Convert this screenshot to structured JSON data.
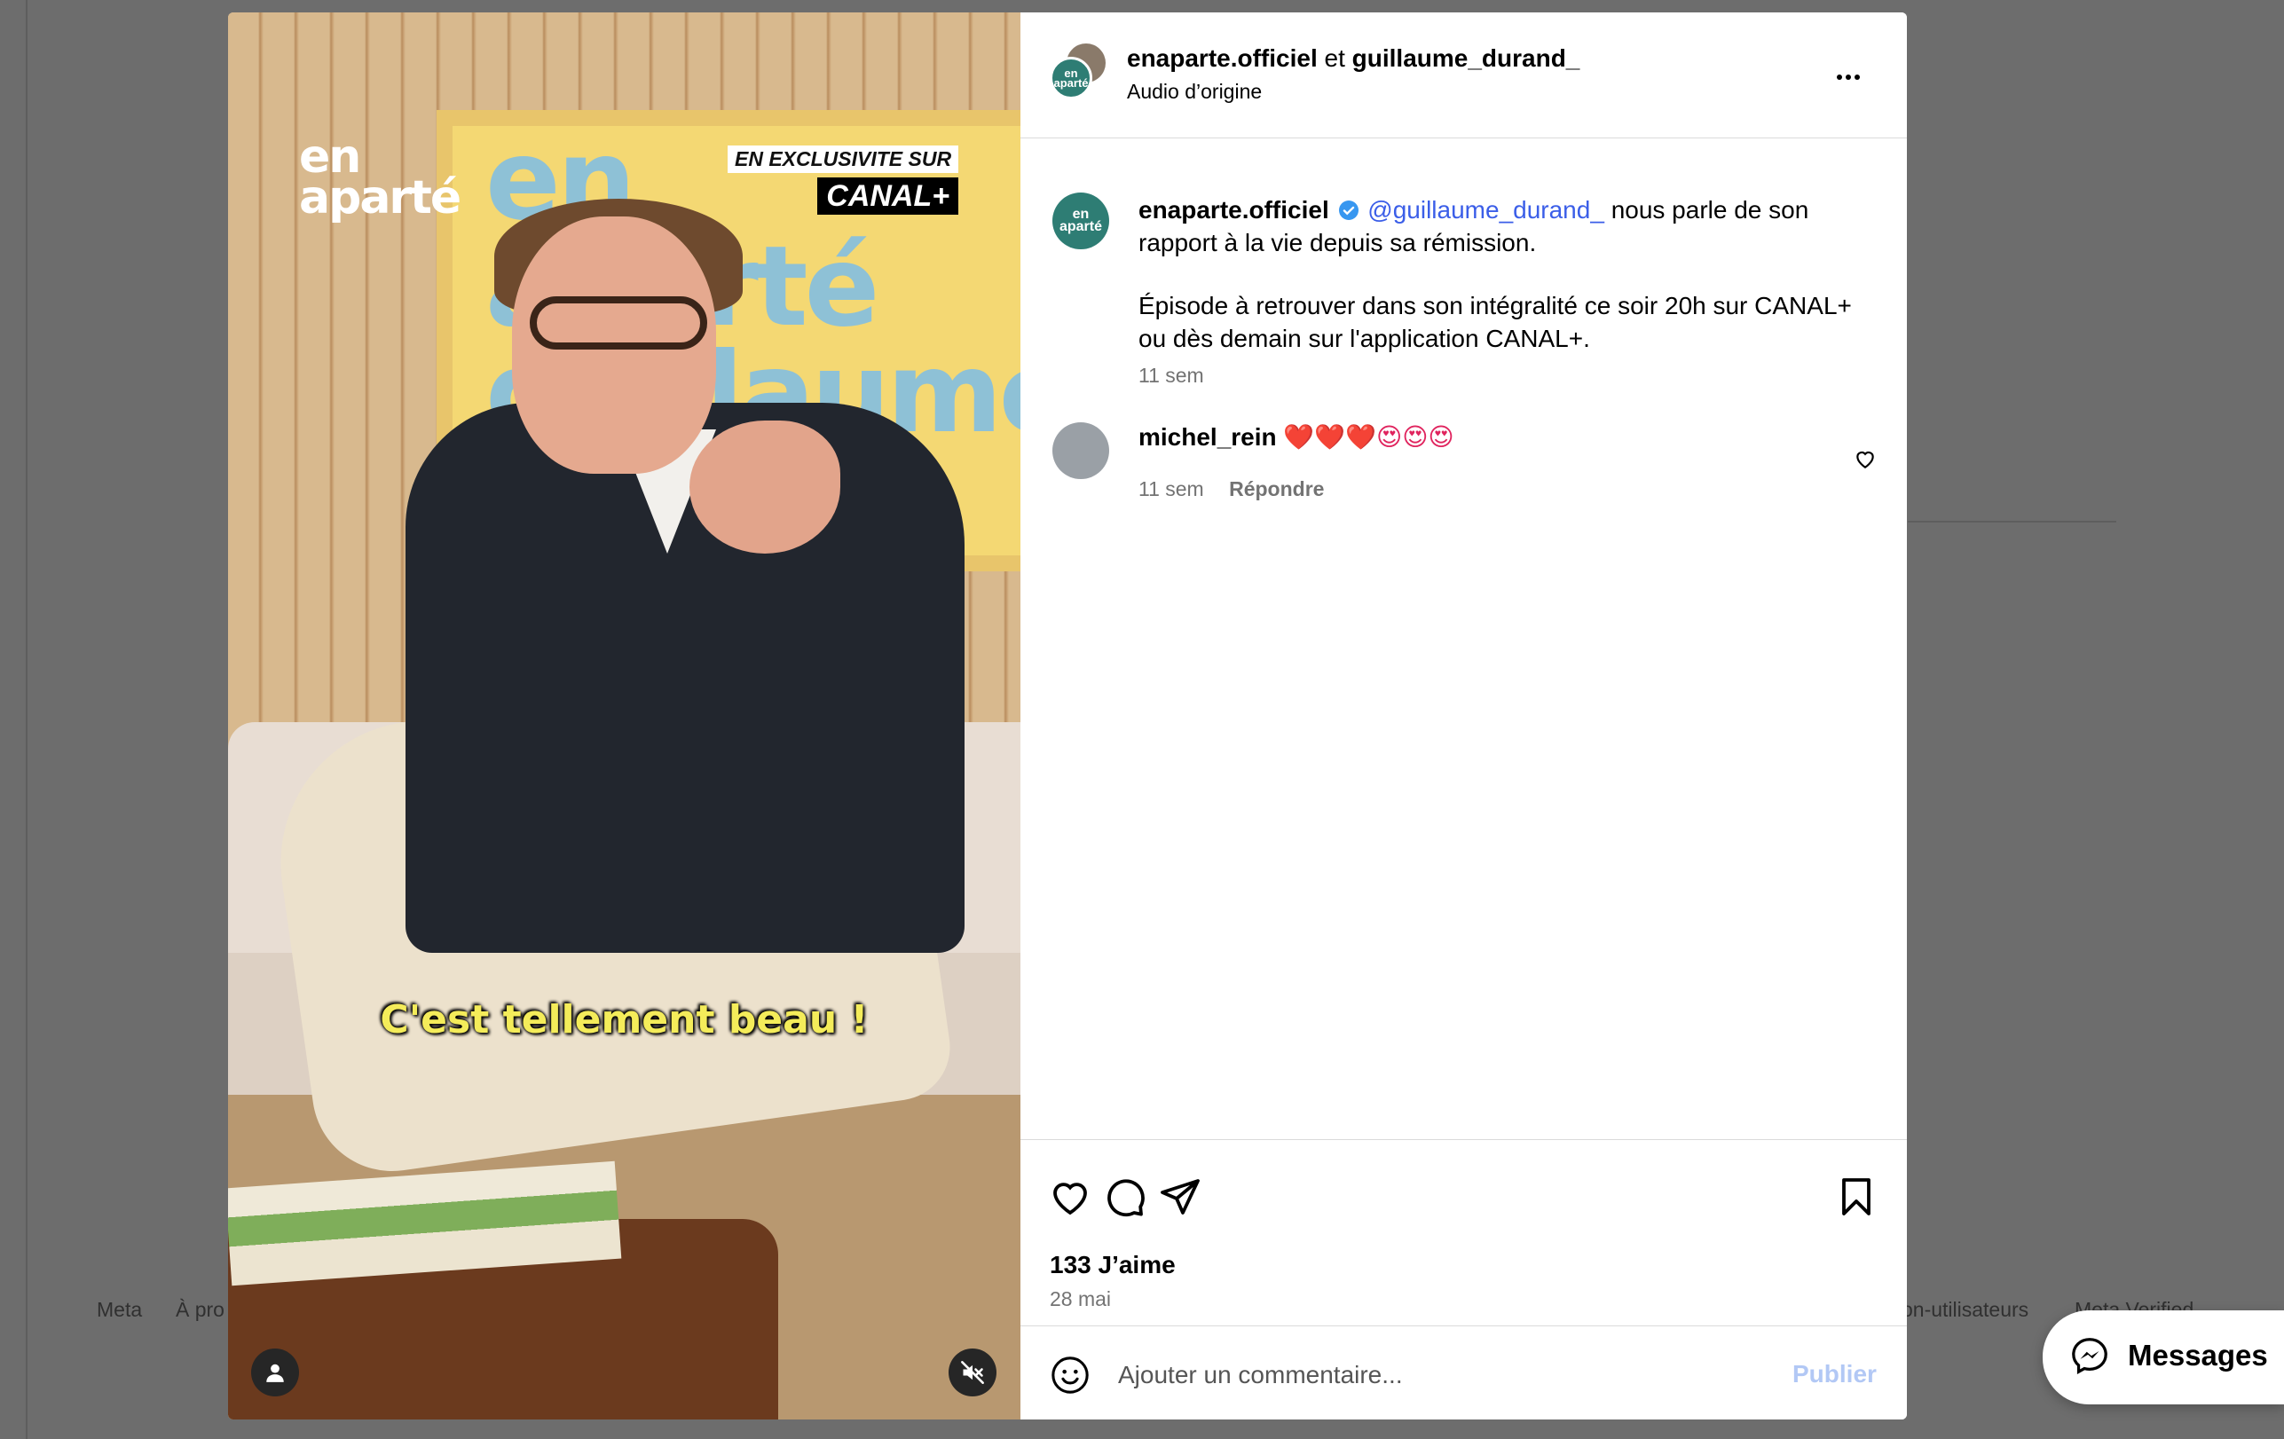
{
  "footer": {
    "meta": "Meta",
    "about": "À pro",
    "non_users": "on-utilisateurs",
    "meta_verified": "Meta Verified"
  },
  "video": {
    "logo_line1": "en",
    "logo_line2": "aparté",
    "exclusive_label": "EN EXCLUSIVITE SUR",
    "canal_label": "CANAL+",
    "subtitle": "C'est tellement beau !"
  },
  "header": {
    "user1": "enaparte.officiel",
    "joiner": "et",
    "user2": "guillaume_durand_",
    "audio": "Audio d’origine",
    "avatar_text": "en aparté"
  },
  "caption": {
    "username": "enaparte.officiel",
    "mention": "@guillaume_durand_",
    "text1": "nous parle de son rapport à la vie depuis sa rémission.",
    "text2": "Épisode à retrouver dans son intégralité ce soir 20h sur CANAL+ ou dès demain sur l'application CANAL+.",
    "time": "11 sem",
    "avatar_text": "en aparté"
  },
  "comment": {
    "username": "michel_rein",
    "emojis": "❤️❤️❤️😍😍😍",
    "time": "11 sem",
    "reply": "Répondre"
  },
  "actions": {
    "likes": "133 J’aime",
    "date": "28 mai"
  },
  "add_comment": {
    "placeholder": "Ajouter un commentaire...",
    "publish": "Publier"
  },
  "messages": {
    "label": "Messages"
  },
  "colors": {
    "mention": "#3b5ee8",
    "publish_disabled": "#b2c8f5",
    "verified": "#3897f0"
  }
}
